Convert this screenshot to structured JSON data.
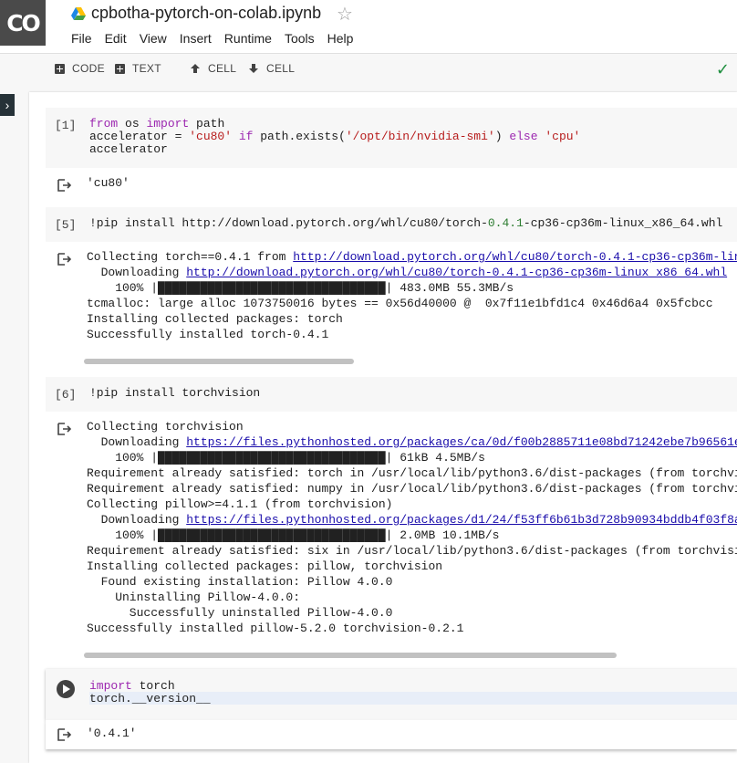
{
  "header": {
    "logo": "CO",
    "notebook_title": "cpbotha-pytorch-on-colab.ipynb",
    "menu": [
      "File",
      "Edit",
      "View",
      "Insert",
      "Runtime",
      "Tools",
      "Help"
    ]
  },
  "toolbar": {
    "add_code": "CODE",
    "add_text": "TEXT",
    "cell_up": "CELL",
    "cell_down": "CELL"
  },
  "cells": {
    "c1": {
      "prompt": "[1]",
      "output": "'cu80'"
    },
    "c2": {
      "prompt": "[5]"
    },
    "c3": {
      "prompt": "[6]"
    },
    "c4": {
      "output": "'0.4.1'"
    }
  },
  "colors": {
    "keyword": "#9c27b0",
    "string": "#b71c1c",
    "number": "#2e7d32",
    "link": "#1a0dab",
    "accent_check": "#1e8e3e"
  }
}
